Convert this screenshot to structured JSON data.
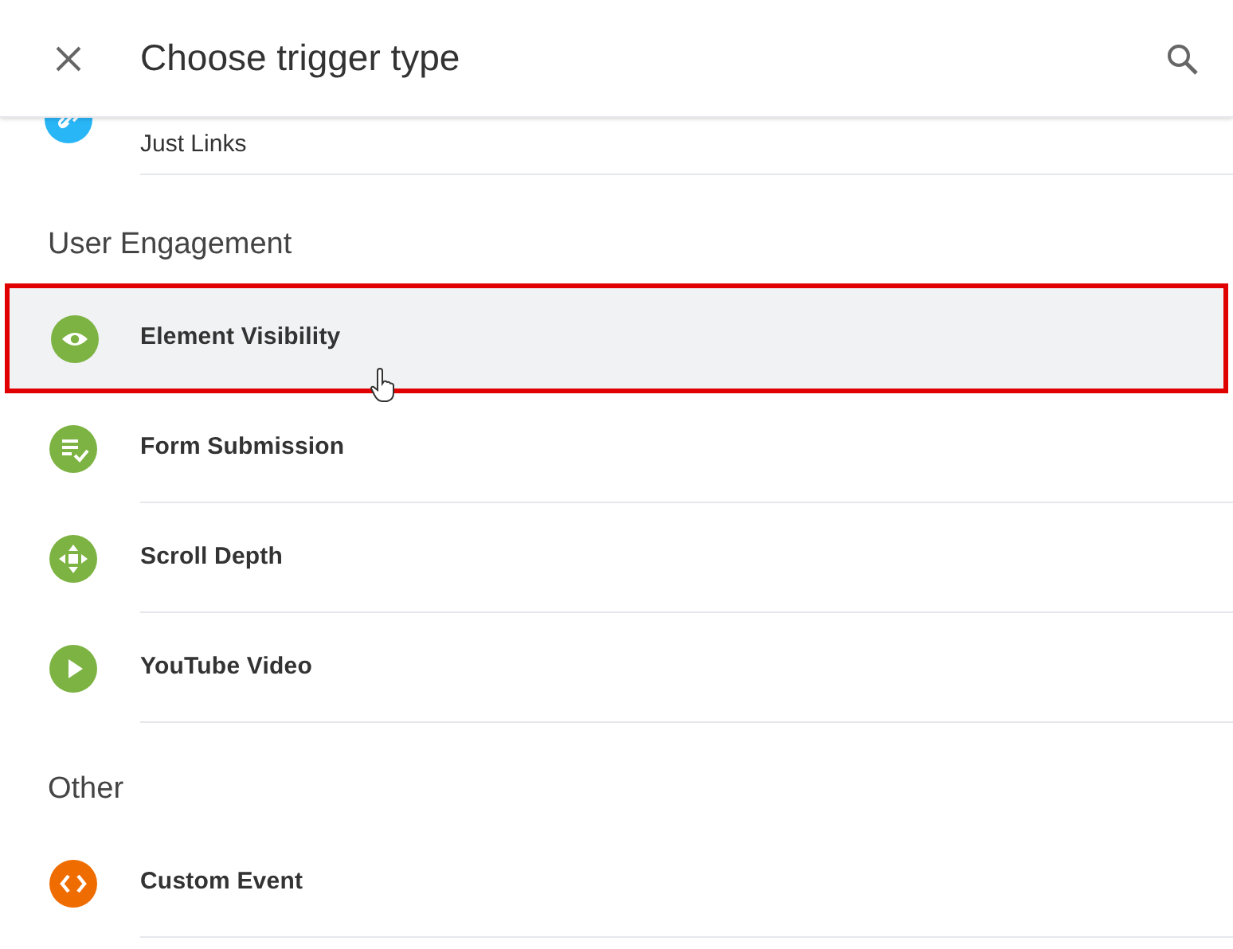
{
  "header": {
    "title": "Choose trigger type"
  },
  "top_item": {
    "label": "Just Links",
    "kind": "link",
    "color": "#29b6f6"
  },
  "sections": [
    {
      "title": "User Engagement",
      "items": [
        {
          "label": "Element Visibility",
          "kind": "eye",
          "color": "#7cb342",
          "selected": true
        },
        {
          "label": "Form Submission",
          "kind": "form",
          "color": "#7cb342",
          "selected": false
        },
        {
          "label": "Scroll Depth",
          "kind": "scroll",
          "color": "#7cb342",
          "selected": false
        },
        {
          "label": "YouTube Video",
          "kind": "play",
          "color": "#7cb342",
          "selected": false
        }
      ]
    },
    {
      "title": "Other",
      "items": [
        {
          "label": "Custom Event",
          "kind": "code",
          "color": "#ef6c00",
          "selected": false
        }
      ]
    }
  ]
}
